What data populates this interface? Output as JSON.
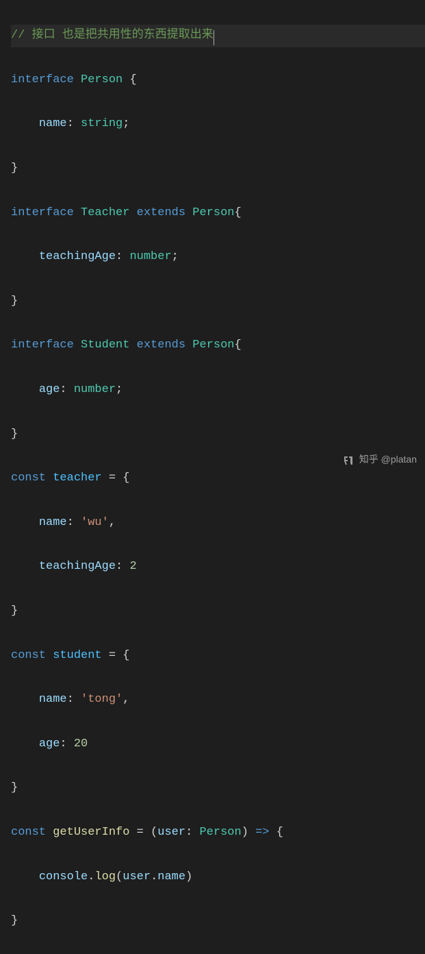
{
  "code": {
    "line1_comment": "// 接口 也是把共用性的东西提取出来",
    "kw_interface": "interface",
    "kw_extends": "extends",
    "kw_const": "const",
    "type_person": "Person",
    "type_teacher": "Teacher",
    "type_student": "Student",
    "type_string": "string",
    "type_number": "number",
    "prop_name": "name",
    "prop_teachingAge": "teachingAge",
    "prop_age": "age",
    "var_teacher": "teacher",
    "var_student": "student",
    "var_getUserInfo": "getUserInfo",
    "var_user": "user",
    "var_console": "console",
    "fn_log": "log",
    "str_wu": "'wu'",
    "str_tong": "'tong'",
    "num_2": "2",
    "num_20": "20",
    "brace_open": "{",
    "brace_close": "}",
    "paren_open": "(",
    "paren_close": ")",
    "colon": ":",
    "comma": ",",
    "semicolon": ";",
    "dot": ".",
    "equals": " = ",
    "arrow": " => ",
    "indent": "    "
  },
  "watermark": {
    "brand": "知乎",
    "handle": "@platan"
  }
}
